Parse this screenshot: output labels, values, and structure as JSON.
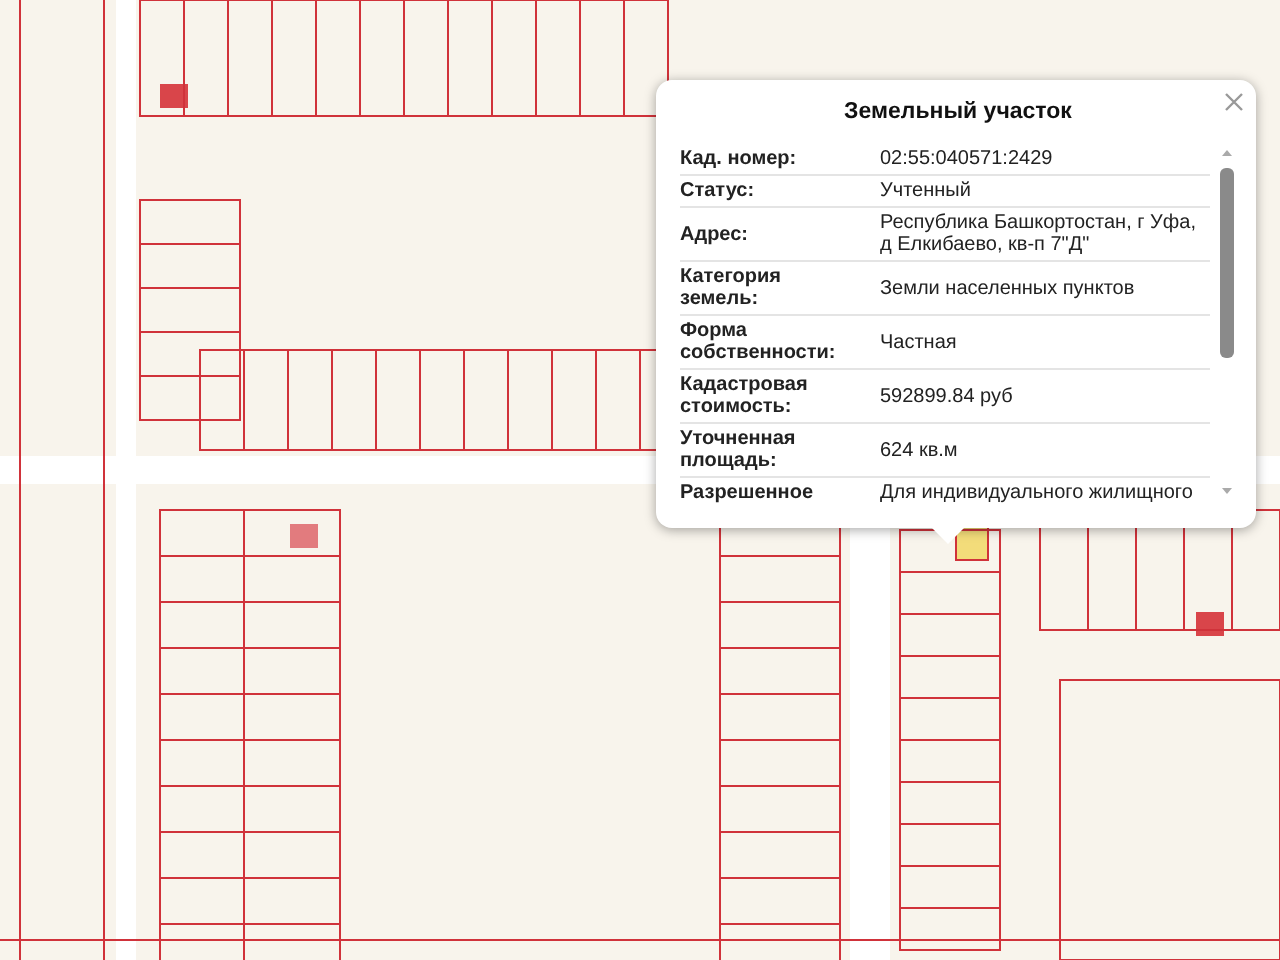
{
  "popup": {
    "title": "Земельный участок",
    "rows": [
      {
        "label": "Кад. номер:",
        "value": "02:55:040571:2429"
      },
      {
        "label": "Статус:",
        "value": "Учтенный"
      },
      {
        "label": "Адрес:",
        "value": "Республика Башкортостан, г Уфа, д Елкибаево, кв-п 7\"Д\""
      },
      {
        "label": "Категория земель:",
        "value": "Земли населенных пунктов"
      },
      {
        "label": "Форма собственности:",
        "value": "Частная"
      },
      {
        "label": "Кадастровая стоимость:",
        "value": "592899.84 руб"
      },
      {
        "label": "Уточненная площадь:",
        "value": "624 кв.м"
      },
      {
        "label": "Разрешенное",
        "value": "Для индивидуального жилищного"
      }
    ]
  }
}
